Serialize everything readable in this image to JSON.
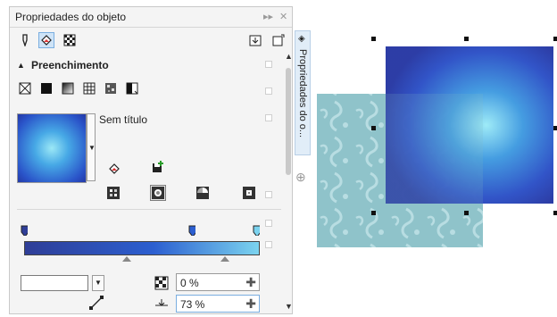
{
  "docker": {
    "title": "Propriedades do objeto",
    "section_title": "Preenchimento",
    "fill_name": "Sem título",
    "transparency_value": "0 %",
    "midpoint_value": "73 %",
    "side_tab_label": "Propriedades do o..."
  },
  "colors": {
    "accent": "#7aaee0",
    "gradient_start": "#2f3e97",
    "gradient_end": "#7bd3ef"
  },
  "icons": {
    "titlebar": [
      "collapse-arrows-icon",
      "close-icon"
    ],
    "tabs": [
      "pen-outline-icon",
      "fill-bucket-icon",
      "transparency-icon"
    ],
    "fill_types": [
      "no-fill-icon",
      "uniform-fill-icon",
      "fountain-fill-icon",
      "vector-pattern-icon",
      "bitmap-pattern-icon",
      "two-color-pattern-icon"
    ]
  }
}
